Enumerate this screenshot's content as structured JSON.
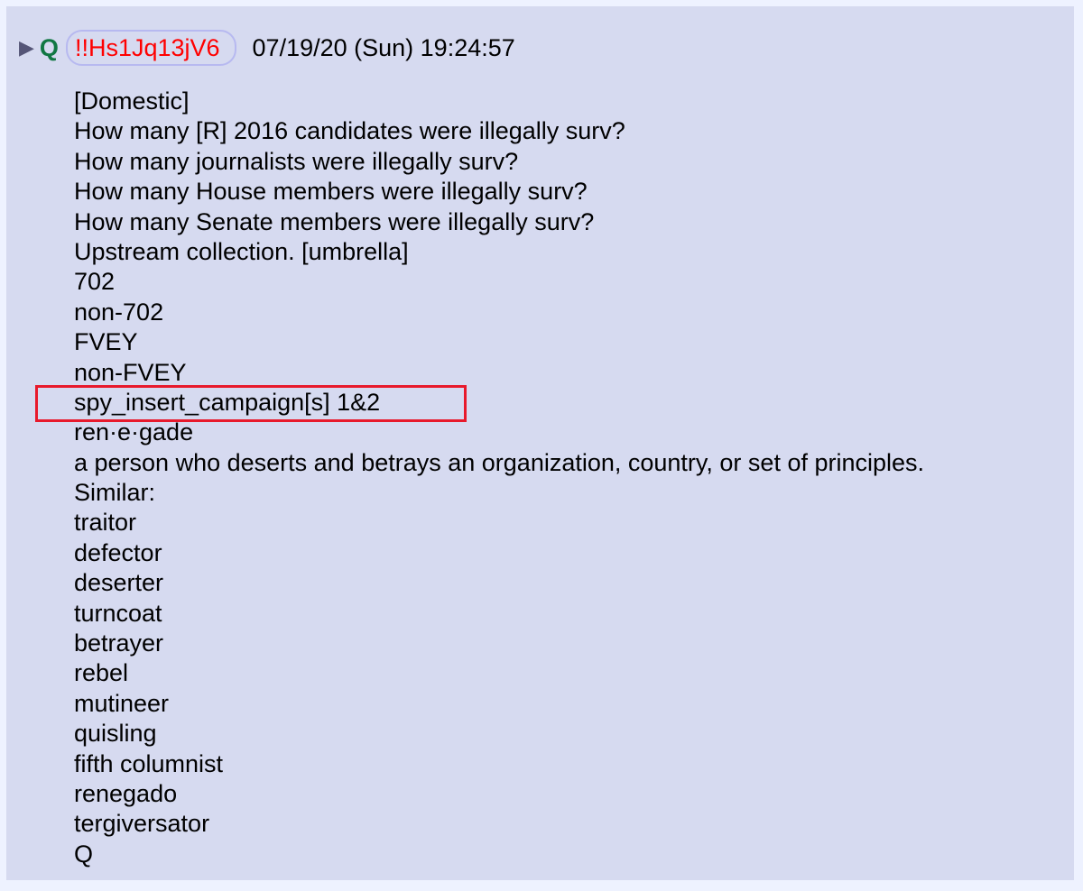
{
  "post": {
    "expand_icon": "triangle-right-icon",
    "name": "Q",
    "tripcode": "!!Hs1Jq13jV6",
    "timestamp": "07/19/20 (Sun) 19:24:57",
    "lines": [
      "[Domestic]",
      "How many [R] 2016 candidates were illegally surv?",
      "How many journalists were illegally surv?",
      "How many House members were illegally surv?",
      "How many Senate members were illegally surv?",
      "Upstream collection. [umbrella]",
      "702",
      "non-702",
      "FVEY",
      "non-FVEY",
      "spy_insert_campaign[s] 1&2",
      "ren·e·gade",
      "a person who deserts and betrays an organization, country, or set of principles.",
      "Similar:",
      "traitor",
      "defector",
      "deserter",
      "turncoat",
      "betrayer",
      "rebel",
      "mutineer",
      "quisling",
      "fifth columnist",
      "renegado",
      "tergiversator",
      "Q"
    ],
    "highlighted_line_index": 10,
    "colors": {
      "name": "#117743",
      "tripcode": "#ff0000",
      "highlight": "#e8192c",
      "post_bg": "#d6daf0",
      "page_bg": "#eef2ff"
    }
  }
}
